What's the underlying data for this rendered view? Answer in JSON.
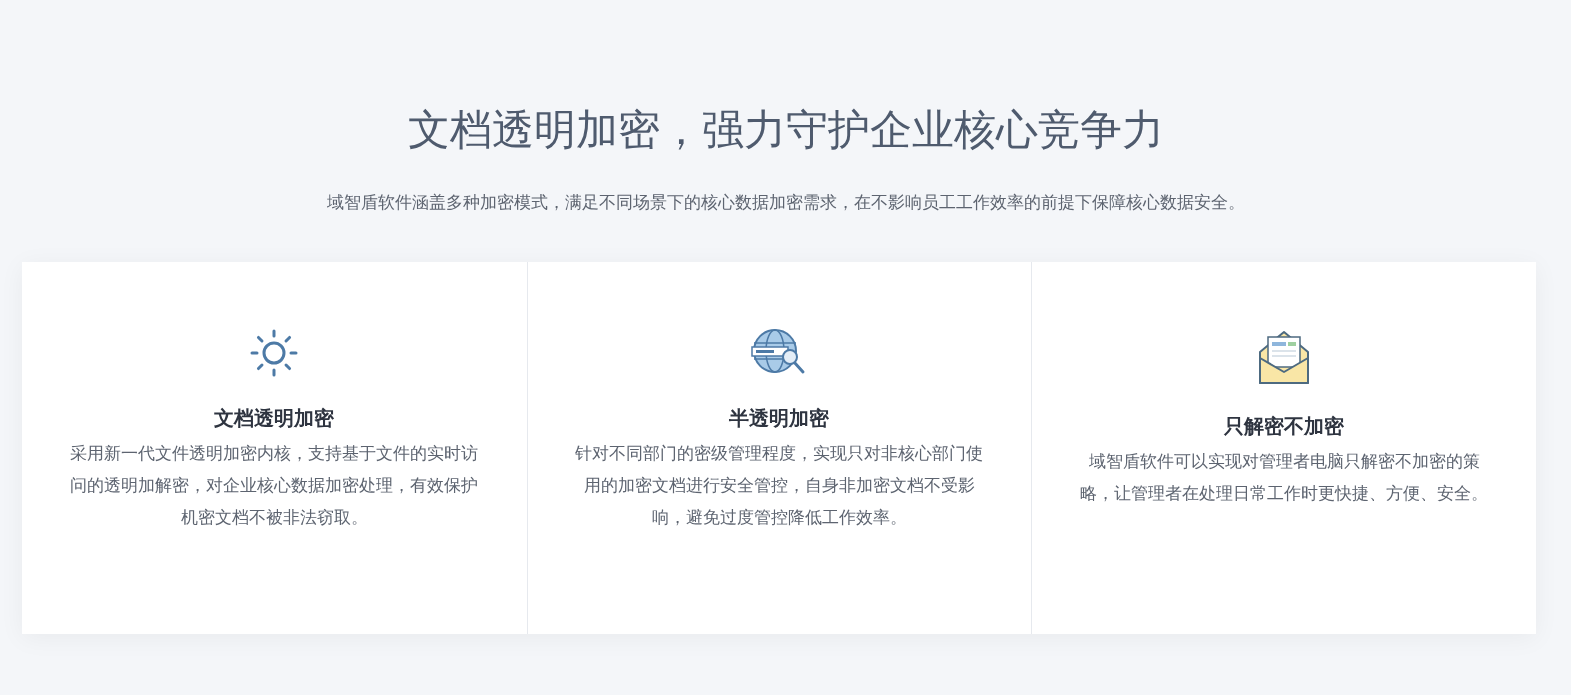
{
  "heading": "文档透明加密，强力守护企业核心竞争力",
  "intro": "域智盾软件涵盖多种加密模式，满足不同场景下的核心数据加密需求，在不影响员工工作效率的前提下保障核心数据安全。",
  "cards": [
    {
      "kind": "sun",
      "title": "文档透明加密",
      "text": "采用新一代文件透明加密内核，支持基于文件的实时访问的透明加解密，对企业核心数据加密处理，有效保护机密文档不被非法窃取。"
    },
    {
      "kind": "globe",
      "title": "半透明加密",
      "text": "针对不同部门的密级管理程度，实现只对非核心部门使用的加密文档进行安全管控，自身非加密文档不受影响，避免过度管控降低工作效率。"
    },
    {
      "kind": "mail",
      "title": "只解密不加密",
      "text": "域智盾软件可以实现对管理者电脑只解密不加密的策略，让管理者在处理日常工作时更快捷、方便、安全。"
    }
  ]
}
